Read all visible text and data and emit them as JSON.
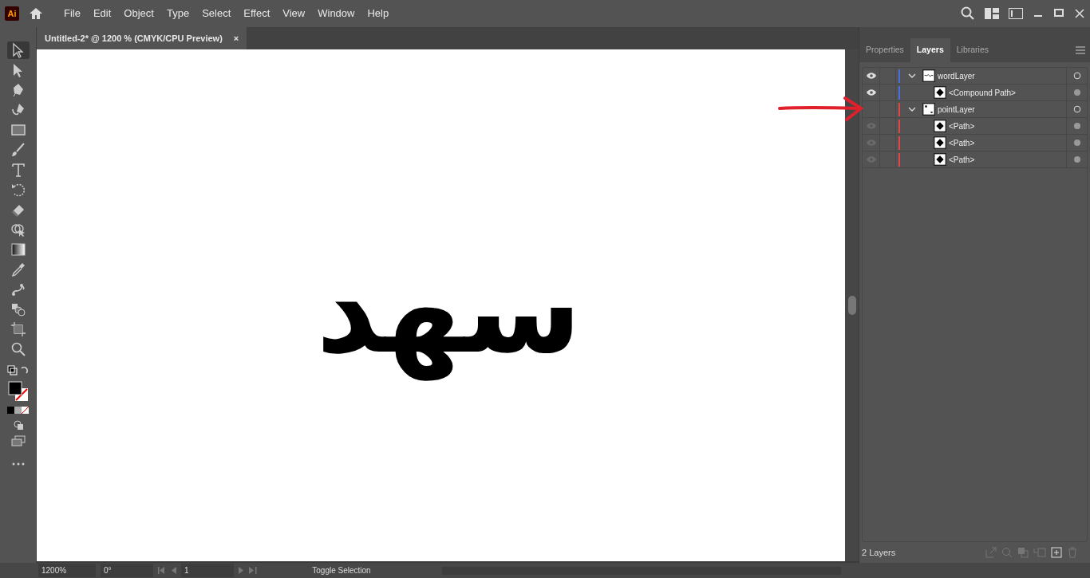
{
  "app": {
    "logo": "Ai"
  },
  "menu": [
    "File",
    "Edit",
    "Object",
    "Type",
    "Select",
    "Effect",
    "View",
    "Window",
    "Help"
  ],
  "document_tab": {
    "title": "Untitled-2* @ 1200 % (CMYK/CPU Preview)",
    "close": "×"
  },
  "tools": [
    {
      "selected": true
    },
    {
      "selected": false
    },
    {
      "selected": false
    },
    {
      "selected": false
    },
    {
      "selected": false
    },
    {
      "selected": false
    },
    {
      "selected": false
    },
    {
      "selected": false
    },
    {
      "selected": false
    },
    {
      "selected": false
    },
    {
      "selected": false
    },
    {
      "selected": false
    },
    {
      "selected": false
    },
    {
      "selected": false
    },
    {
      "selected": false
    },
    {
      "selected": false
    }
  ],
  "canvas": {
    "artwork_text": "سهد"
  },
  "annotation": {
    "kind": "arrow",
    "color": "#e0202a"
  },
  "panel": {
    "tabs": [
      {
        "label": "Properties",
        "selected": false
      },
      {
        "label": "Layers",
        "selected": true
      },
      {
        "label": "Libraries",
        "selected": false
      }
    ],
    "layers": [
      {
        "name": "wordLayer",
        "kind": "layer",
        "visible": true,
        "expanded": true,
        "color": "#4a6fe0",
        "children": [
          {
            "name": "<Compound Path>",
            "kind": "object",
            "visible": true
          }
        ]
      },
      {
        "name": "pointLayer",
        "kind": "layer",
        "visible": false,
        "expanded": true,
        "color": "#e04848",
        "children": [
          {
            "name": "<Path>",
            "kind": "object",
            "visible": true
          },
          {
            "name": "<Path>",
            "kind": "object",
            "visible": true
          },
          {
            "name": "<Path>",
            "kind": "object",
            "visible": true
          }
        ]
      }
    ],
    "footer": "2 Layers"
  },
  "status_bar": {
    "zoom": "1200%",
    "rotation": "0°",
    "artboard": "1",
    "toggle": "Toggle Selection"
  }
}
